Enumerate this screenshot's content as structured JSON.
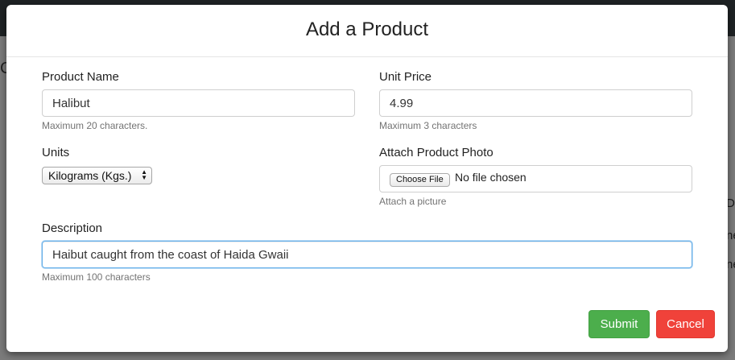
{
  "background": {
    "left_fragment": "C",
    "right_fragments": [
      "De",
      "ne",
      "ne"
    ]
  },
  "modal": {
    "title": "Add a Product",
    "product_name": {
      "label": "Product Name",
      "value": "Halibut",
      "help": "Maximum 20 characters."
    },
    "unit_price": {
      "label": "Unit Price",
      "value": "4.99",
      "help": "Maximum 3 characters"
    },
    "units": {
      "label": "Units",
      "selected": "Kilograms (Kgs.)"
    },
    "photo": {
      "label": "Attach Product Photo",
      "button": "Choose File",
      "status": "No file chosen",
      "help": "Attach a picture"
    },
    "description": {
      "label": "Description",
      "value": "Haibut caught from the coast of Haida Gwaii",
      "help": "Maximum 100 characters"
    },
    "buttons": {
      "submit": "Submit",
      "cancel": "Cancel"
    }
  },
  "colors": {
    "submit": "#4cae4c",
    "cancel": "#f0423a",
    "focus_border": "#66afe9",
    "topbar": "#1e2224"
  }
}
